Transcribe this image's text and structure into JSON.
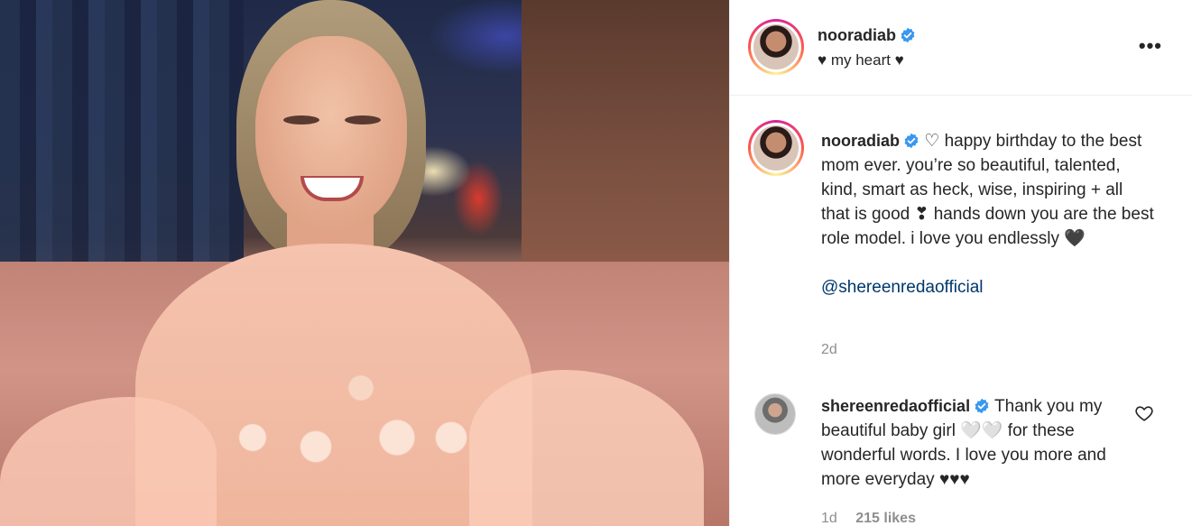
{
  "post": {
    "author": "nooradiab",
    "author_subtitle": "♥ my heart ♥",
    "more_label": "•••",
    "caption": "♡ happy birthday to the best mom ever. you’re so beautiful, talented, kind, smart as heck, wise, inspiring + all that is good ❣ hands down you are the best role model. i love you endlessly 🖤",
    "mention": "@shereenredaofficial",
    "age": "2d"
  },
  "comments": [
    {
      "author": "shereenredaofficial",
      "text": "Thank you my beautiful baby girl 🤍🤍 for these wonderful words. I love you more and more everyday ♥♥♥",
      "age": "1d",
      "likes": "215 likes"
    }
  ],
  "colors": {
    "verified": "#3897f0",
    "link": "#00376b",
    "muted": "#8e8e8e"
  },
  "icons": {
    "verified": "verified-badge-icon",
    "more": "more-options-icon",
    "like": "heart-outline-icon"
  }
}
